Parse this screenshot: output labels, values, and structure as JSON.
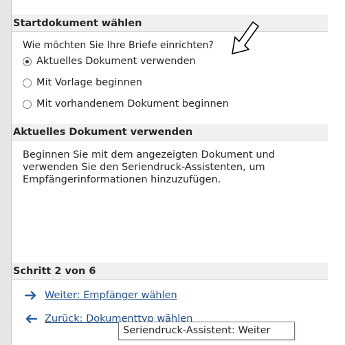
{
  "start_document": {
    "header": "Startdokument wählen",
    "question": "Wie möchten Sie Ihre Briefe einrichten?",
    "options": [
      {
        "label": "Aktuelles Dokument verwenden",
        "checked": true
      },
      {
        "label": "Mit Vorlage beginnen",
        "checked": false
      },
      {
        "label": "Mit vorhandenem Dokument beginnen",
        "checked": false
      }
    ]
  },
  "current_document": {
    "header": "Aktuelles Dokument verwenden",
    "description": "Beginnen Sie mit dem angezeigten Dokument und\nverwenden Sie den Seriendruck-Assistenten, um\nEmpfängerinformationen hinzuzufügen."
  },
  "step": {
    "header": "Schritt 2 von 6",
    "next_label": "Weiter: Empfänger wählen",
    "back_label": "Zurück: Dokumenttyp wählen"
  },
  "tooltip": "Seriendruck-Assistent: Weiter",
  "colors": {
    "link": "#1f4e8c",
    "arrow": "#2b5fa8",
    "header_bg": "#f0f0f0"
  },
  "icons": {
    "next": "arrow-right-icon",
    "back": "arrow-left-icon",
    "cursor": "mouse-cursor-icon"
  }
}
